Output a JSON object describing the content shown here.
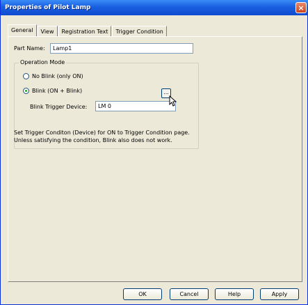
{
  "window": {
    "title": "Properties of Pilot Lamp",
    "close_symbol": "×"
  },
  "tabs": [
    {
      "label": "General",
      "active": true
    },
    {
      "label": "View",
      "active": false
    },
    {
      "label": "Registration Text",
      "active": false
    },
    {
      "label": "Trigger Condition",
      "active": false
    }
  ],
  "general": {
    "part_name_label": "Part Name:",
    "part_name_value": "Lamp1",
    "operation_mode": {
      "title": "Operation Mode",
      "options": [
        {
          "label": "No Blink (only ON)",
          "selected": false
        },
        {
          "label": "Blink (ON + Blink)",
          "selected": true
        }
      ],
      "trigger_label": "Blink Trigger Device:",
      "trigger_value": "LM 0",
      "browse_label": "..."
    },
    "note_lines": [
      "Set Trigger Conditon (Device) for ON to Trigger Condition page.",
      "Unless satisfying the condition, Blink also does not work."
    ]
  },
  "buttons": {
    "ok": "OK",
    "cancel": "Cancel",
    "help": "Help",
    "apply": "Apply"
  }
}
